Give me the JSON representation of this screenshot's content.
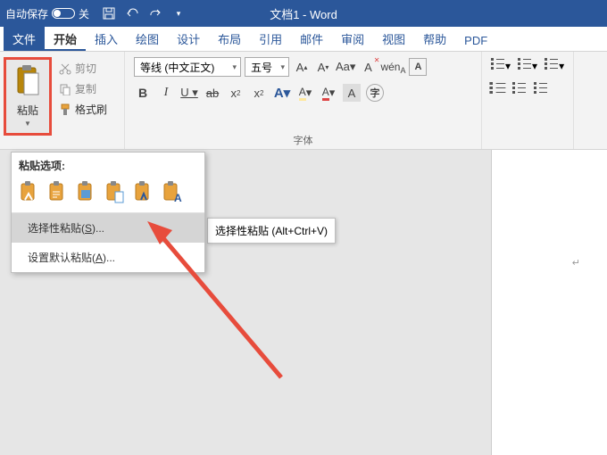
{
  "titlebar": {
    "autosave_label": "自动保存",
    "autosave_state": "关",
    "doc_title": "文档1 - Word"
  },
  "tabs": {
    "file": "文件",
    "home": "开始",
    "insert": "插入",
    "draw": "绘图",
    "design": "设计",
    "layout": "布局",
    "references": "引用",
    "mailings": "邮件",
    "review": "审阅",
    "view": "视图",
    "help": "帮助",
    "pdf": "PDF"
  },
  "ribbon": {
    "clipboard": {
      "paste": "粘贴",
      "cut": "剪切",
      "copy": "复制",
      "format_painter": "格式刷"
    },
    "font": {
      "name": "等线 (中文正文)",
      "size": "五号",
      "group_label": "字体",
      "wen_btn": "wén"
    }
  },
  "dropdown": {
    "header": "粘贴选项:",
    "paste_special_prefix": "选择性粘贴(",
    "paste_special_key": "S",
    "paste_special_suffix": ")...",
    "set_default_prefix": "设置默认粘贴(",
    "set_default_key": "A",
    "set_default_suffix": ")..."
  },
  "tooltip": "选择性粘贴 (Alt+Ctrl+V)",
  "doc_mark": "↵"
}
